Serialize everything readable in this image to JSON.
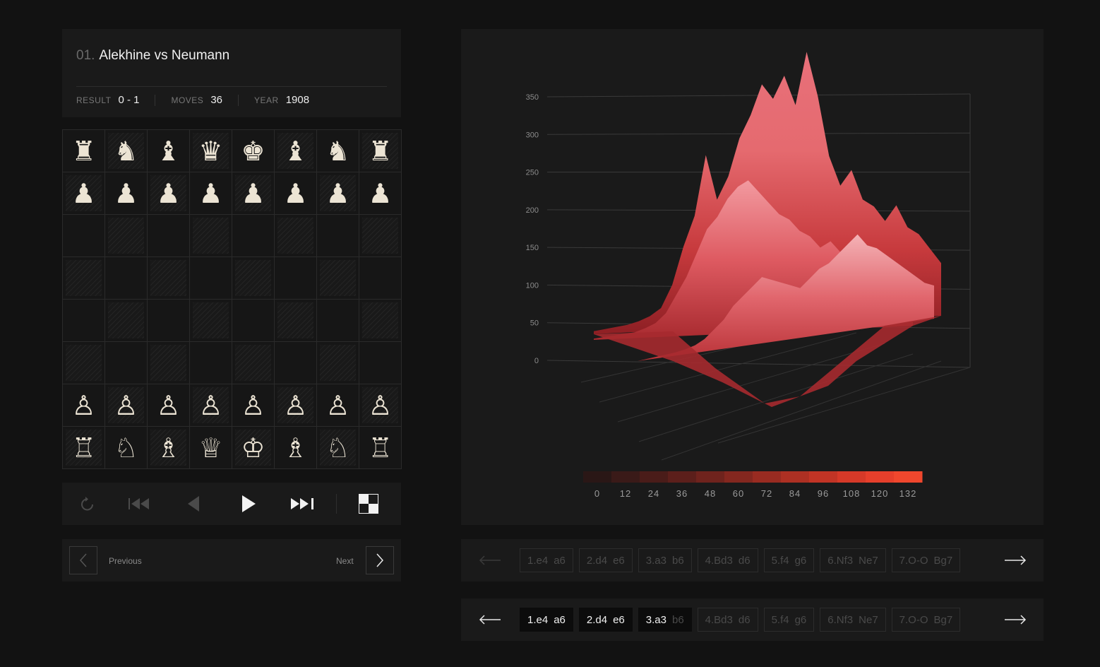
{
  "game": {
    "index": "01.",
    "title": "Alekhine vs Neumann",
    "stats": [
      {
        "label": "RESULT",
        "value": "0 - 1"
      },
      {
        "label": "MOVES",
        "value": "36"
      },
      {
        "label": "YEAR",
        "value": "1908"
      }
    ]
  },
  "board": {
    "ranks": [
      [
        "♜",
        "♞",
        "♝",
        "♛",
        "♚",
        "♝",
        "♞",
        "♜"
      ],
      [
        "♟",
        "♟",
        "♟",
        "♟",
        "♟",
        "♟",
        "♟",
        "♟"
      ],
      [
        "",
        "",
        "",
        "",
        "",
        "",
        "",
        ""
      ],
      [
        "",
        "",
        "",
        "",
        "",
        "",
        "",
        ""
      ],
      [
        "",
        "",
        "",
        "",
        "",
        "",
        "",
        ""
      ],
      [
        "",
        "",
        "",
        "",
        "",
        "",
        "",
        ""
      ],
      [
        "♙",
        "♙",
        "♙",
        "♙",
        "♙",
        "♙",
        "♙",
        "♙"
      ],
      [
        "♖",
        "♘",
        "♗",
        "♕",
        "♔",
        "♗",
        "♘",
        "♖"
      ]
    ]
  },
  "controls": [
    {
      "name": "reset-icon"
    },
    {
      "name": "skip-to-start-icon"
    },
    {
      "name": "step-back-icon"
    },
    {
      "name": "play-icon"
    },
    {
      "name": "skip-to-end-icon"
    },
    {
      "name": "flip-board-icon"
    }
  ],
  "pager": {
    "previous_label": "Previous",
    "next_label": "Next"
  },
  "chart_data": {
    "type": "surface",
    "z_ticks": [
      "350",
      "300",
      "250",
      "200",
      "150",
      "100",
      "50",
      "0"
    ],
    "zlim": [
      0,
      350
    ],
    "colorbar": {
      "ticks": [
        "0",
        "12",
        "24",
        "36",
        "48",
        "60",
        "72",
        "84",
        "96",
        "108",
        "120",
        "132"
      ],
      "range": [
        0,
        132
      ],
      "colors": [
        "#2a1716",
        "#3a1a18",
        "#4a1c19",
        "#5c1f1b",
        "#6f231d",
        "#84271f",
        "#992b21",
        "#ad3023",
        "#c23425",
        "#d63928",
        "#e63f2b",
        "#f0472d"
      ]
    },
    "profiles": [
      [
        4,
        6,
        8,
        10,
        14,
        20,
        30,
        60,
        110,
        150,
        230,
        170,
        200,
        250,
        280,
        320,
        300,
        330,
        290,
        360,
        300,
        220,
        180,
        200,
        160,
        150,
        130,
        150,
        120,
        110,
        90,
        70
      ],
      [
        2,
        4,
        6,
        8,
        10,
        16,
        24,
        40,
        70,
        100,
        140,
        180,
        200,
        230,
        250,
        260,
        240,
        220,
        200,
        190,
        170,
        160,
        140,
        150,
        130,
        120,
        110,
        100,
        90,
        80,
        70,
        60
      ],
      [
        0,
        2,
        4,
        6,
        8,
        12,
        18,
        30,
        50,
        70,
        100,
        120,
        140,
        160,
        150,
        140,
        130,
        120,
        140,
        160,
        170,
        190,
        210,
        230,
        200,
        190,
        170,
        150,
        130,
        110,
        90,
        80
      ]
    ]
  },
  "move_rows": [
    {
      "moves": [
        {
          "w": "1.e4",
          "b": "a6"
        },
        {
          "w": "2.d4",
          "b": "e6"
        },
        {
          "w": "3.a3",
          "b": "b6"
        },
        {
          "w": "4.Bd3",
          "b": "d6"
        },
        {
          "w": "5.f4",
          "b": "g6"
        },
        {
          "w": "6.Nf3",
          "b": "Ne7"
        },
        {
          "w": "7.O-O",
          "b": "Bg7"
        }
      ],
      "played": 0
    },
    {
      "moves": [
        {
          "w": "1.e4",
          "b": "a6"
        },
        {
          "w": "2.d4",
          "b": "e6"
        },
        {
          "w": "3.a3",
          "b": "b6"
        },
        {
          "w": "4.Bd3",
          "b": "d6"
        },
        {
          "w": "5.f4",
          "b": "g6"
        },
        {
          "w": "6.Nf3",
          "b": "Ne7"
        },
        {
          "w": "7.O-O",
          "b": "Bg7"
        }
      ],
      "played": 2.5
    }
  ]
}
